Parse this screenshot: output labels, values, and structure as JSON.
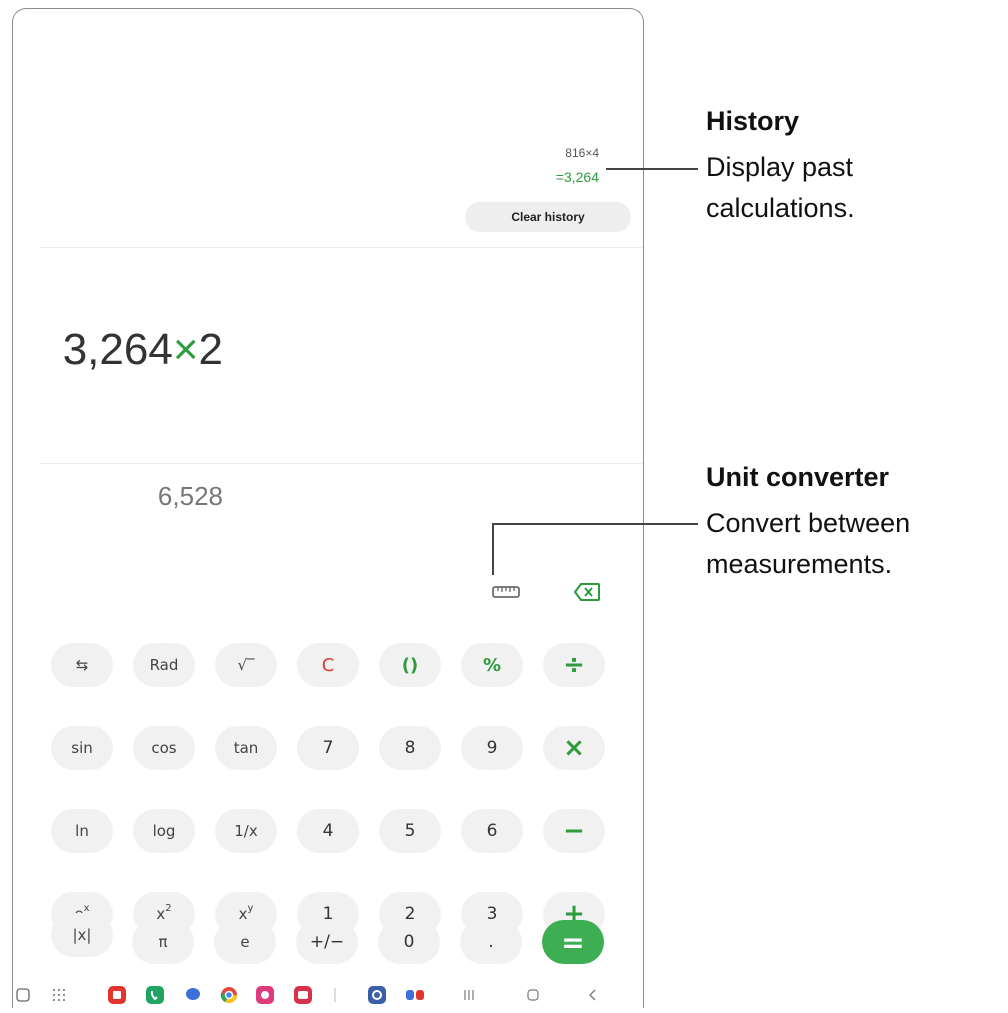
{
  "history": {
    "expression": "816×4",
    "result": "=3,264",
    "clear_label": "Clear history"
  },
  "display": {
    "expression_num1": "3,264",
    "expression_op": "×",
    "expression_num2": "2",
    "result": "6,528"
  },
  "keys": [
    [
      "⇆",
      "Rad",
      "√‾",
      "C",
      "()",
      "%",
      "÷"
    ],
    [
      "sin",
      "cos",
      "tan",
      "7",
      "8",
      "9",
      "×"
    ],
    [
      "ln",
      "log",
      "1/x",
      "4",
      "5",
      "6",
      "−"
    ],
    [
      "e",
      "x",
      "x",
      "1",
      "2",
      "3",
      "+"
    ],
    [
      "|x|",
      "π",
      "e",
      "+/−",
      "0",
      ".",
      "="
    ]
  ],
  "superscripts": {
    "ex": "x",
    "x2": "2",
    "xy": "y"
  },
  "annotations": {
    "history_title": "History",
    "history_desc_1": "Display past",
    "history_desc_2": "calculations.",
    "unit_title": "Unit converter",
    "unit_desc_1": "Convert between",
    "unit_desc_2": "measurements."
  },
  "colors": {
    "accent": "#2e9b3c",
    "clear": "#e03a2f",
    "equals_bg": "#3daf52",
    "key_bg": "#f1f1f1"
  },
  "icons": [
    "ruler-icon",
    "backspace-icon",
    "swap-icon"
  ]
}
